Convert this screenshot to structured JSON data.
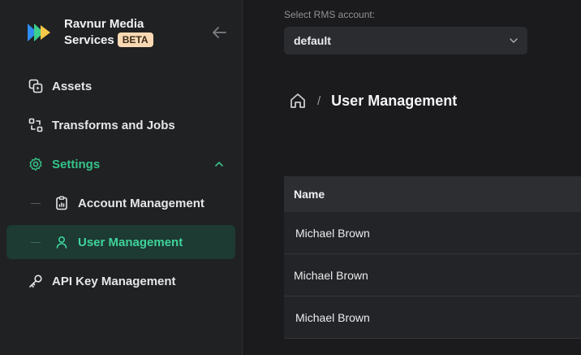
{
  "app": {
    "name_line1": "Ravnur Media",
    "name_line2": "Services",
    "badge": "BETA"
  },
  "colors": {
    "accent": "#35c48a",
    "selected_bg": "#1d3a33",
    "badge_bg": "#f9d9b4"
  },
  "sidebar": {
    "items": [
      {
        "label": "Assets",
        "icon": "assets-icon"
      },
      {
        "label": "Transforms and Jobs",
        "icon": "transforms-icon"
      },
      {
        "label": "Settings",
        "icon": "gear-icon",
        "expanded": true
      },
      {
        "label": "Account Management",
        "icon": "clipboard-icon"
      },
      {
        "label": "User Management",
        "icon": "user-icon",
        "selected": true
      },
      {
        "label": "API Key Management",
        "icon": "key-icon"
      }
    ]
  },
  "rms": {
    "label": "Select RMS account:",
    "value": "default"
  },
  "breadcrumb": {
    "separator": "/",
    "title": "User Management"
  },
  "table": {
    "columns": [
      "Name"
    ],
    "rows": [
      {
        "name": "Michael Brown"
      },
      {
        "name": "Michael Brown"
      },
      {
        "name": "Michael Brown"
      }
    ]
  }
}
